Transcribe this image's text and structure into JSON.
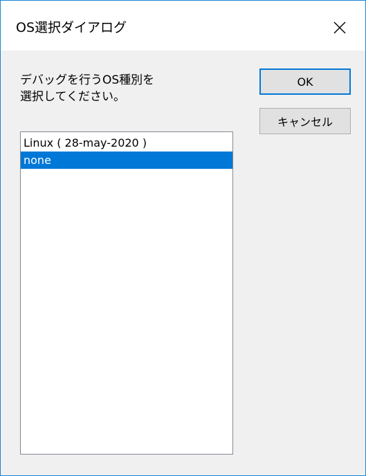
{
  "window": {
    "title": "OS選択ダイアログ",
    "close_icon": "close-icon"
  },
  "prompt": {
    "line1": "デバッグを行うOS種別を",
    "line2": "選択してください。"
  },
  "buttons": {
    "ok_label": "OK",
    "cancel_label": "キャンセル"
  },
  "os_list": {
    "items": [
      {
        "label": "Linux ( 28-may-2020 )",
        "selected": false
      },
      {
        "label": "none",
        "selected": true
      }
    ]
  },
  "colors": {
    "accent": "#0078d7",
    "window_border": "#1883d7",
    "dialog_background": "#f0f0f0",
    "button_background": "#e1e1e1"
  }
}
